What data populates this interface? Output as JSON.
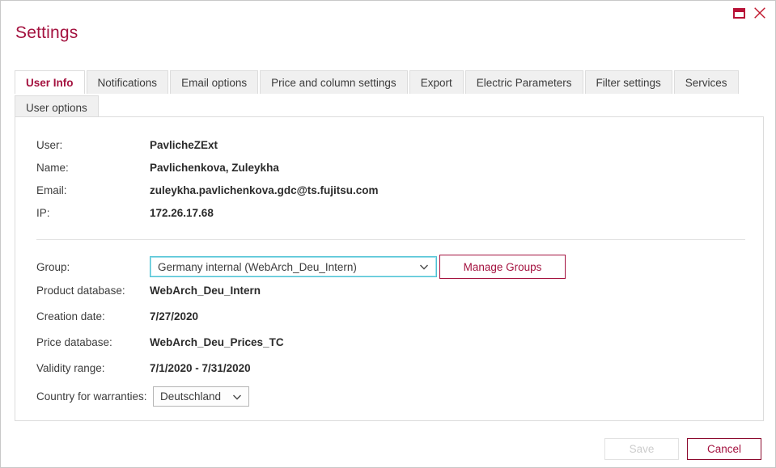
{
  "window": {
    "restore_icon": "restore-window-icon",
    "close_icon": "close-window-icon"
  },
  "title": "Settings",
  "tabs": {
    "row1": [
      {
        "label": "User Info",
        "active": true
      },
      {
        "label": "Notifications",
        "active": false
      },
      {
        "label": "Email options",
        "active": false
      },
      {
        "label": "Price and column settings",
        "active": false
      },
      {
        "label": "Export",
        "active": false
      },
      {
        "label": "Electric Parameters",
        "active": false
      },
      {
        "label": "Filter settings",
        "active": false
      },
      {
        "label": "Services",
        "active": false
      }
    ],
    "row2": [
      {
        "label": "User options",
        "active": true
      }
    ]
  },
  "user_info": {
    "user_label": "User:",
    "user_value": "PavlicheZExt",
    "name_label": "Name:",
    "name_value": "Pavlichenkova, Zuleykha",
    "email_label": "Email:",
    "email_value": "zuleykha.pavlichenkova.gdc@ts.fujitsu.com",
    "ip_label": "IP:",
    "ip_value": "172.26.17.68"
  },
  "group_section": {
    "group_label": "Group:",
    "group_selected": "Germany internal (WebArch_Deu_Intern)",
    "manage_groups_label": "Manage Groups",
    "product_db_label": "Product database:",
    "product_db_value": "WebArch_Deu_Intern",
    "creation_date_label": "Creation date:",
    "creation_date_value": "7/27/2020",
    "price_db_label": "Price database:",
    "price_db_value": "WebArch_Deu_Prices_TC",
    "validity_label": "Validity range:",
    "validity_value": "7/1/2020 - 7/31/2020",
    "country_label": "Country for warranties:",
    "country_selected": "Deutschland"
  },
  "footer": {
    "save_label": "Save",
    "cancel_label": "Cancel"
  },
  "colors": {
    "brand_red": "#a4123f",
    "close_red": "#c0162c",
    "focus_cyan": "#4cc2d4",
    "tab_gray": "#f0f0f0",
    "border_gray": "#dcdcdc"
  }
}
